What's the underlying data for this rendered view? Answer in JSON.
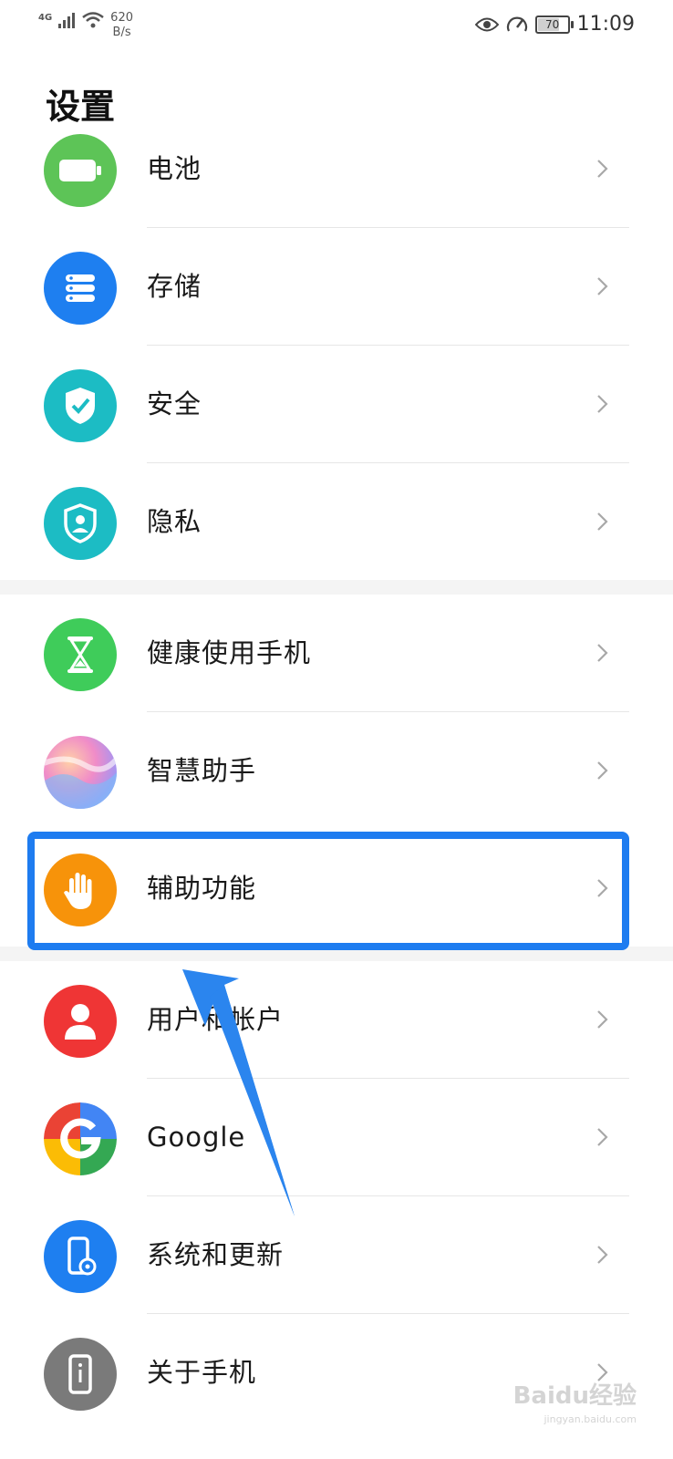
{
  "status_bar": {
    "network": "4G",
    "speed_value": "620",
    "speed_unit": "B/s",
    "battery": "70",
    "time": "11:09"
  },
  "page": {
    "title": "设置"
  },
  "items": [
    {
      "label": "电池",
      "icon": "battery-icon",
      "color": "#5dc457"
    },
    {
      "label": "存储",
      "icon": "storage-icon",
      "color": "#1e7ff0"
    },
    {
      "label": "安全",
      "icon": "shield-check-icon",
      "color": "#1cbcc4"
    },
    {
      "label": "隐私",
      "icon": "privacy-shield-icon",
      "color": "#1cbcc4"
    },
    {
      "label": "健康使用手机",
      "icon": "hourglass-icon",
      "color": "#3fcc5a"
    },
    {
      "label": "智慧助手",
      "icon": "assistant-icon",
      "color": "#d8b8f0"
    },
    {
      "label": "辅助功能",
      "icon": "hand-icon",
      "color": "#f7930a"
    },
    {
      "label": "用户和帐户",
      "icon": "user-icon",
      "color": "#ef3535"
    },
    {
      "label": "Google",
      "icon": "google-icon",
      "color": "#4285f4"
    },
    {
      "label": "系统和更新",
      "icon": "phone-gear-icon",
      "color": "#1e7ff0"
    },
    {
      "label": "关于手机",
      "icon": "phone-info-icon",
      "color": "#7a7a7a"
    }
  ],
  "watermark": {
    "brand": "Baidu经验",
    "url": "jingyan.baidu.com"
  },
  "colors": {
    "highlight": "#1e7cf0",
    "arrow": "#2b85ee"
  }
}
